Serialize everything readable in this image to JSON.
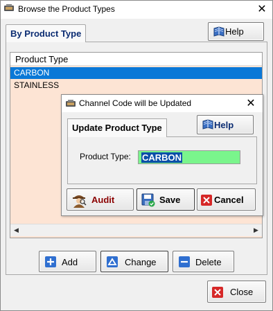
{
  "window": {
    "title": "Browse the Product Types"
  },
  "tabs": {
    "active": "By Product Type"
  },
  "help": {
    "label": "Help"
  },
  "list": {
    "header": "Product Type",
    "rows": [
      "CARBON",
      "STAINLESS"
    ],
    "selected_index": 0
  },
  "dialog": {
    "title": "Channel Code will be Updated",
    "tab": "Update Product Type",
    "help_label": "Help",
    "field_label": "Product Type:",
    "field_value": "CARBON",
    "audit_label": "Audit",
    "save_label": "Save",
    "cancel_label": "Cancel"
  },
  "actions": {
    "add_label": "Add",
    "change_label": "Change",
    "delete_label": "Delete",
    "close_label": "Close"
  },
  "colors": {
    "selection": "#0a78d7",
    "list_bg": "#fde4d4",
    "field_bg": "#7af58c",
    "tab_text": "#0b2c72",
    "audit_text": "#8b0000"
  }
}
